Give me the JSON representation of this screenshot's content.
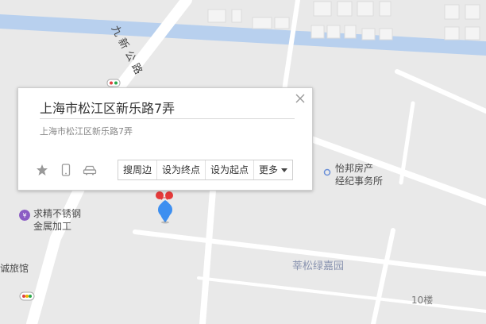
{
  "map": {
    "road_labels": {
      "jiuxin_road": "九新公路"
    },
    "poi_labels": {
      "yibang_realestate_line1": "怡邦房产",
      "yibang_realestate_line2": "经纪事务所",
      "qiujing_stainless_line1": "求精不锈钢",
      "qiujing_stainless_line2": "金属加工",
      "chengdu_hotel": "诚旅馆",
      "xinsong_lvjiayuan": "莘松绿嘉园",
      "building_10": "10楼"
    },
    "colors": {
      "background": "#e9e9e9",
      "road": "#ffffff",
      "canal": "#b8d0ee",
      "pin": "#3d8ff0",
      "poi_purple": "#8b5cc4",
      "poi_blue": "#6a8fd8"
    }
  },
  "popup": {
    "title": "上海市松江区新乐路7弄",
    "address": "上海市松江区新乐路7弄",
    "actions": {
      "nearby": "搜周边",
      "set_end": "设为终点",
      "set_start": "设为起点",
      "more": "更多"
    },
    "icons": [
      "star-icon",
      "phone-icon",
      "car-icon"
    ],
    "close_icon": "close-icon"
  }
}
